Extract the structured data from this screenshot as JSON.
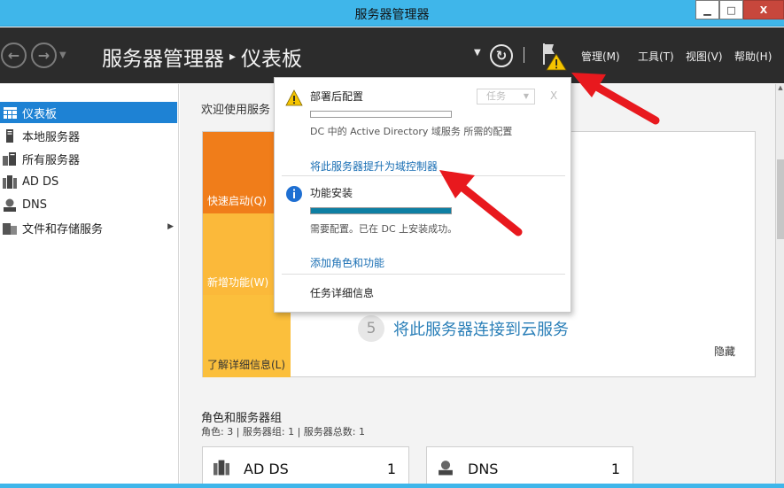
{
  "window": {
    "title": "服务器管理器",
    "minimize": "▁",
    "maximize": "□",
    "close": "X"
  },
  "toolbar": {
    "breadcrumb_root": "服务器管理器",
    "breadcrumb_sep": "▸",
    "breadcrumb_current": "仪表板",
    "menus": [
      "管理(M)",
      "工具(T)",
      "视图(V)",
      "帮助(H)"
    ]
  },
  "sidebar": {
    "items": [
      {
        "label": "仪表板",
        "icon": "dashboard-icon",
        "active": true
      },
      {
        "label": "本地服务器",
        "icon": "local-server-icon",
        "active": false
      },
      {
        "label": "所有服务器",
        "icon": "all-servers-icon",
        "active": false
      },
      {
        "label": "AD DS",
        "icon": "ad-ds-icon",
        "active": false
      },
      {
        "label": "DNS",
        "icon": "dns-icon",
        "active": false
      },
      {
        "label": "文件和存储服务",
        "icon": "file-storage-icon",
        "active": false,
        "expandable": true
      }
    ]
  },
  "main": {
    "welcome_title": "欢迎使用服务",
    "tiles": [
      "快速启动(Q)",
      "新增功能(W)",
      "了解详细信息(L)"
    ],
    "cloud_step_number": "5",
    "cloud_step_text": "将此服务器连接到云服务",
    "hide": "隐藏",
    "roles_title": "角色和服务器组",
    "roles_sub": "角色: 3 | 服务器组: 1 | 服务器总数: 1",
    "role_cards": [
      {
        "name": "AD DS",
        "count": "1",
        "icon": "ad-ds-icon"
      },
      {
        "name": "DNS",
        "count": "1",
        "icon": "dns-icon"
      }
    ]
  },
  "notifications": {
    "post_deploy": {
      "title": "部署后配置",
      "task_label": "任务",
      "close": "X",
      "description": "DC 中的 Active Directory 域服务 所需的配置",
      "link": "将此服务器提升为域控制器",
      "icon": "warning-icon"
    },
    "feature_install": {
      "title": "功能安装",
      "progress": 1.0,
      "description": "需要配置。已在 DC 上安装成功。",
      "link": "添加角色和功能",
      "icon": "info-icon"
    },
    "task_details": "任务详细信息"
  },
  "colors": {
    "titlebar": "#3fb6ea",
    "toolbar": "#2c2c2c",
    "accent": "#1e82d4",
    "tile_orange": "#f07d1a",
    "tile_yellow": "#fbb93a",
    "link": "#1a6fb4",
    "arrow": "#e8191e"
  }
}
